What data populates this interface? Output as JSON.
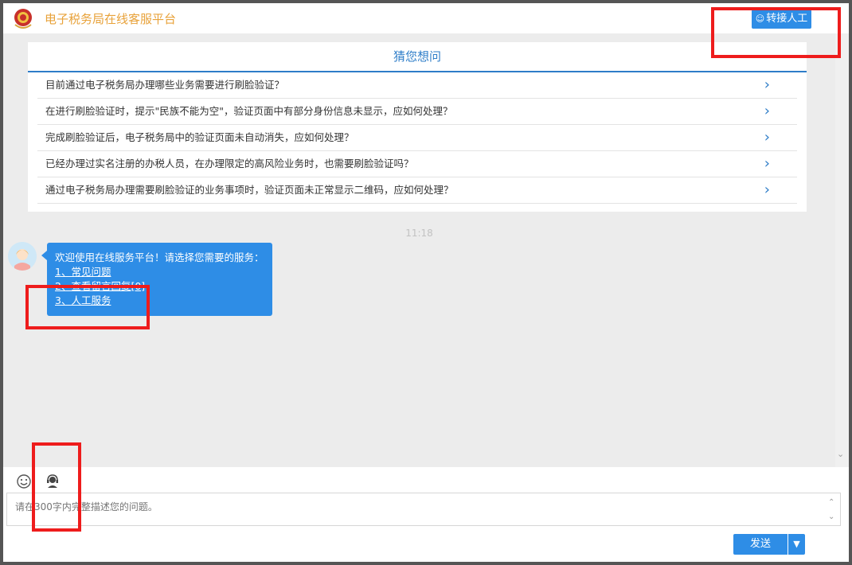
{
  "header": {
    "title": "电子税务局在线客服平台",
    "transfer_button": "转接人工"
  },
  "guess": {
    "title": "猜您想问",
    "items": [
      {
        "text": "目前通过电子税务局办理哪些业务需要进行刷脸验证？"
      },
      {
        "text": "在进行刷脸验证时，提示\"民族不能为空\"，验证页面中有部分身份信息未显示，应如何处理？"
      },
      {
        "text": "完成刷脸验证后，电子税务局中的验证页面未自动消失，应如何处理？"
      },
      {
        "text": "已经办理过实名注册的办税人员，在办理限定的高风险业务时，也需要刷脸验证吗？"
      },
      {
        "text": "通过电子税务局办理需要刷脸验证的业务事项时，验证页面未正常显示二维码，应如何处理？"
      }
    ]
  },
  "chat": {
    "timestamp": "11:18",
    "bot_message": {
      "intro": "欢迎使用在线服务平台！请选择您需要的服务：",
      "options": [
        "1、常见问题",
        "2、查看留言回复[0]",
        "3、人工服务"
      ]
    }
  },
  "composer": {
    "placeholder": "请在300字内完整描述您的问题。",
    "send_label": "发送",
    "emoji_icon": "smiley-icon",
    "agent_icon": "headset-agent-icon"
  },
  "colors": {
    "accent": "#2e8de6",
    "title": "#e8a23a",
    "highlight": "#ee1c1c"
  }
}
